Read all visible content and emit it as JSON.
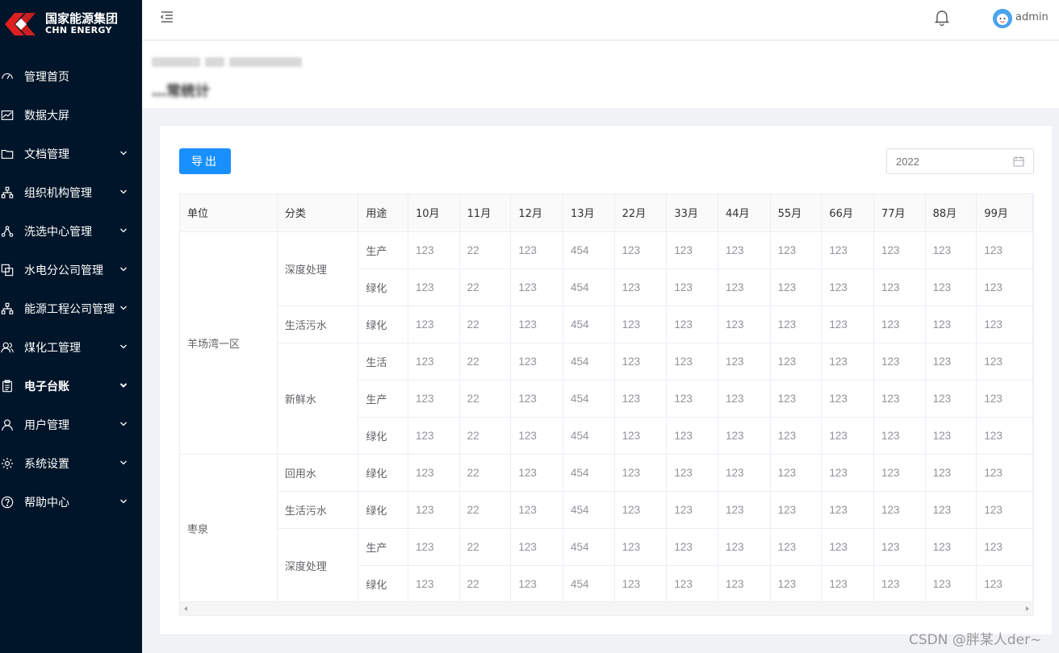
{
  "brand": {
    "name_cn": "国家能源集团",
    "name_en": "CHN ENERGY",
    "logo_color": "#e02020"
  },
  "sidebar": {
    "items": [
      {
        "label": "管理首页",
        "icon": "speedometer-icon",
        "has_children": false
      },
      {
        "label": "数据大屏",
        "icon": "line-chart-icon",
        "has_children": false
      },
      {
        "label": "文档管理",
        "icon": "folder-icon",
        "has_children": true
      },
      {
        "label": "组织机构管理",
        "icon": "org-tree-icon",
        "has_children": true
      },
      {
        "label": "洗选中心管理",
        "icon": "share-nodes-icon",
        "has_children": true
      },
      {
        "label": "水电分公司管理",
        "icon": "copy-icon",
        "has_children": true
      },
      {
        "label": "能源工程公司管理",
        "icon": "org-tree-icon",
        "has_children": true
      },
      {
        "label": "煤化工管理",
        "icon": "users-icon",
        "has_children": true
      },
      {
        "label": "电子台账",
        "icon": "clipboard-icon",
        "has_children": true,
        "active": true
      },
      {
        "label": "用户管理",
        "icon": "user-icon",
        "has_children": true
      },
      {
        "label": "系统设置",
        "icon": "gear-icon",
        "has_children": true
      },
      {
        "label": "帮助中心",
        "icon": "question-icon",
        "has_children": true
      }
    ]
  },
  "header": {
    "username": "admin",
    "fold_icon": "menu-fold-icon",
    "bell_icon": "bell-icon"
  },
  "page": {
    "title": "…常统计"
  },
  "toolbar": {
    "export_label": "导出",
    "year_placeholder": "2022"
  },
  "table": {
    "columns": [
      "单位",
      "分类",
      "用途",
      "10月",
      "11月",
      "12月",
      "13月",
      "22月",
      "33月",
      "44月",
      "55月",
      "66月",
      "77月",
      "88月",
      "99月"
    ],
    "groups": [
      {
        "unit": "羊场湾一区",
        "categories": [
          {
            "name": "深度处理",
            "rows": [
              {
                "use": "生产",
                "values": [
                  "123",
                  "22",
                  "123",
                  "454",
                  "123",
                  "123",
                  "123",
                  "123",
                  "123",
                  "123",
                  "123",
                  "123"
                ]
              },
              {
                "use": "绿化",
                "values": [
                  "123",
                  "22",
                  "123",
                  "454",
                  "123",
                  "123",
                  "123",
                  "123",
                  "123",
                  "123",
                  "123",
                  "123"
                ]
              }
            ]
          },
          {
            "name": "生活污水",
            "rows": [
              {
                "use": "绿化",
                "values": [
                  "123",
                  "22",
                  "123",
                  "454",
                  "123",
                  "123",
                  "123",
                  "123",
                  "123",
                  "123",
                  "123",
                  "123"
                ]
              }
            ]
          },
          {
            "name": "新鲜水",
            "rows": [
              {
                "use": "生活",
                "values": [
                  "123",
                  "22",
                  "123",
                  "454",
                  "123",
                  "123",
                  "123",
                  "123",
                  "123",
                  "123",
                  "123",
                  "123"
                ]
              },
              {
                "use": "生产",
                "values": [
                  "123",
                  "22",
                  "123",
                  "454",
                  "123",
                  "123",
                  "123",
                  "123",
                  "123",
                  "123",
                  "123",
                  "123"
                ]
              },
              {
                "use": "绿化",
                "values": [
                  "123",
                  "22",
                  "123",
                  "454",
                  "123",
                  "123",
                  "123",
                  "123",
                  "123",
                  "123",
                  "123",
                  "123"
                ]
              }
            ]
          }
        ]
      },
      {
        "unit": "枣泉",
        "categories": [
          {
            "name": "回用水",
            "rows": [
              {
                "use": "绿化",
                "values": [
                  "123",
                  "22",
                  "123",
                  "454",
                  "123",
                  "123",
                  "123",
                  "123",
                  "123",
                  "123",
                  "123",
                  "123"
                ]
              }
            ]
          },
          {
            "name": "生活污水",
            "rows": [
              {
                "use": "绿化",
                "values": [
                  "123",
                  "22",
                  "123",
                  "454",
                  "123",
                  "123",
                  "123",
                  "123",
                  "123",
                  "123",
                  "123",
                  "123"
                ]
              }
            ]
          },
          {
            "name": "深度处理",
            "rows": [
              {
                "use": "生产",
                "values": [
                  "123",
                  "22",
                  "123",
                  "454",
                  "123",
                  "123",
                  "123",
                  "123",
                  "123",
                  "123",
                  "123",
                  "123"
                ]
              },
              {
                "use": "绿化",
                "values": [
                  "123",
                  "22",
                  "123",
                  "454",
                  "123",
                  "123",
                  "123",
                  "123",
                  "123",
                  "123",
                  "123",
                  "123"
                ]
              }
            ]
          }
        ]
      }
    ]
  },
  "watermark": "CSDN @胖某人der~",
  "colors": {
    "sidebar_bg": "#001529",
    "primary": "#1890ff",
    "header_bg": "#ffffff"
  }
}
